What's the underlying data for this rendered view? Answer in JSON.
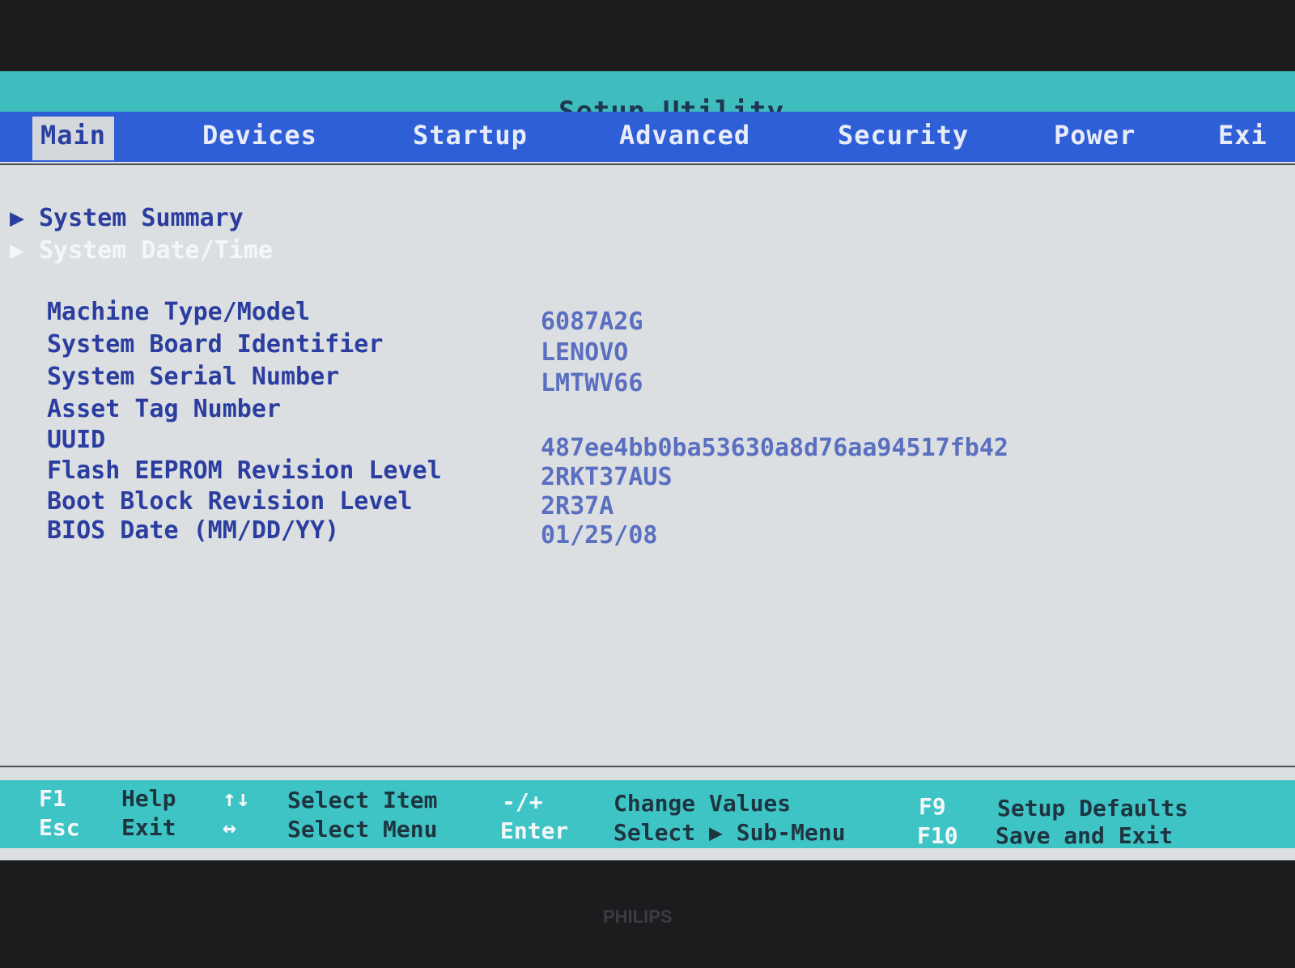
{
  "header": {
    "title": "Setup Utility"
  },
  "tabs": [
    {
      "label": "Main",
      "active": true
    },
    {
      "label": "Devices"
    },
    {
      "label": "Startup"
    },
    {
      "label": "Advanced"
    },
    {
      "label": "Security"
    },
    {
      "label": "Power"
    },
    {
      "label": "Exi"
    }
  ],
  "submenus": [
    {
      "label": "System Summary",
      "icon": "triangle-right-icon"
    },
    {
      "label": "System Date/Time",
      "icon": "triangle-right-icon",
      "selected": true
    }
  ],
  "info": [
    {
      "label": "Machine Type/Model",
      "value": "6087A2G"
    },
    {
      "label": "System Board Identifier",
      "value": "LENOVO"
    },
    {
      "label": "System Serial Number",
      "value": "LMTWV66"
    },
    {
      "label": "Asset Tag Number",
      "value": ""
    },
    {
      "label": "UUID",
      "value": "487ee4bb0ba53630a8d76aa94517fb42"
    },
    {
      "label": "Flash EEPROM Revision Level",
      "value": "2RKT37AUS"
    },
    {
      "label": "Boot Block Revision Level",
      "value": "2R37A"
    },
    {
      "label": "BIOS Date (MM/DD/YY)",
      "value": "01/25/08"
    }
  ],
  "footer": [
    {
      "key": "F1",
      "desc": "Help"
    },
    {
      "key": "Esc",
      "desc": "Exit"
    },
    {
      "key": "↑↓",
      "desc": "Select Item"
    },
    {
      "key": "↔",
      "desc": "Select Menu"
    },
    {
      "key": "-/+",
      "desc": "Change Values"
    },
    {
      "key": "Enter",
      "desc": "Select ▶ Sub-Menu"
    },
    {
      "key": "F9",
      "desc": "Setup Defaults"
    },
    {
      "key": "F10",
      "desc": "Save and Exit"
    }
  ],
  "monitor": {
    "brand": "PHILIPS"
  },
  "colors": {
    "title_bar": "#3fbcbd",
    "tab_bar": "#2f5fd6",
    "background": "#dcdfe1",
    "text": "#2b3ea0",
    "footer": "#3fc4c6"
  }
}
